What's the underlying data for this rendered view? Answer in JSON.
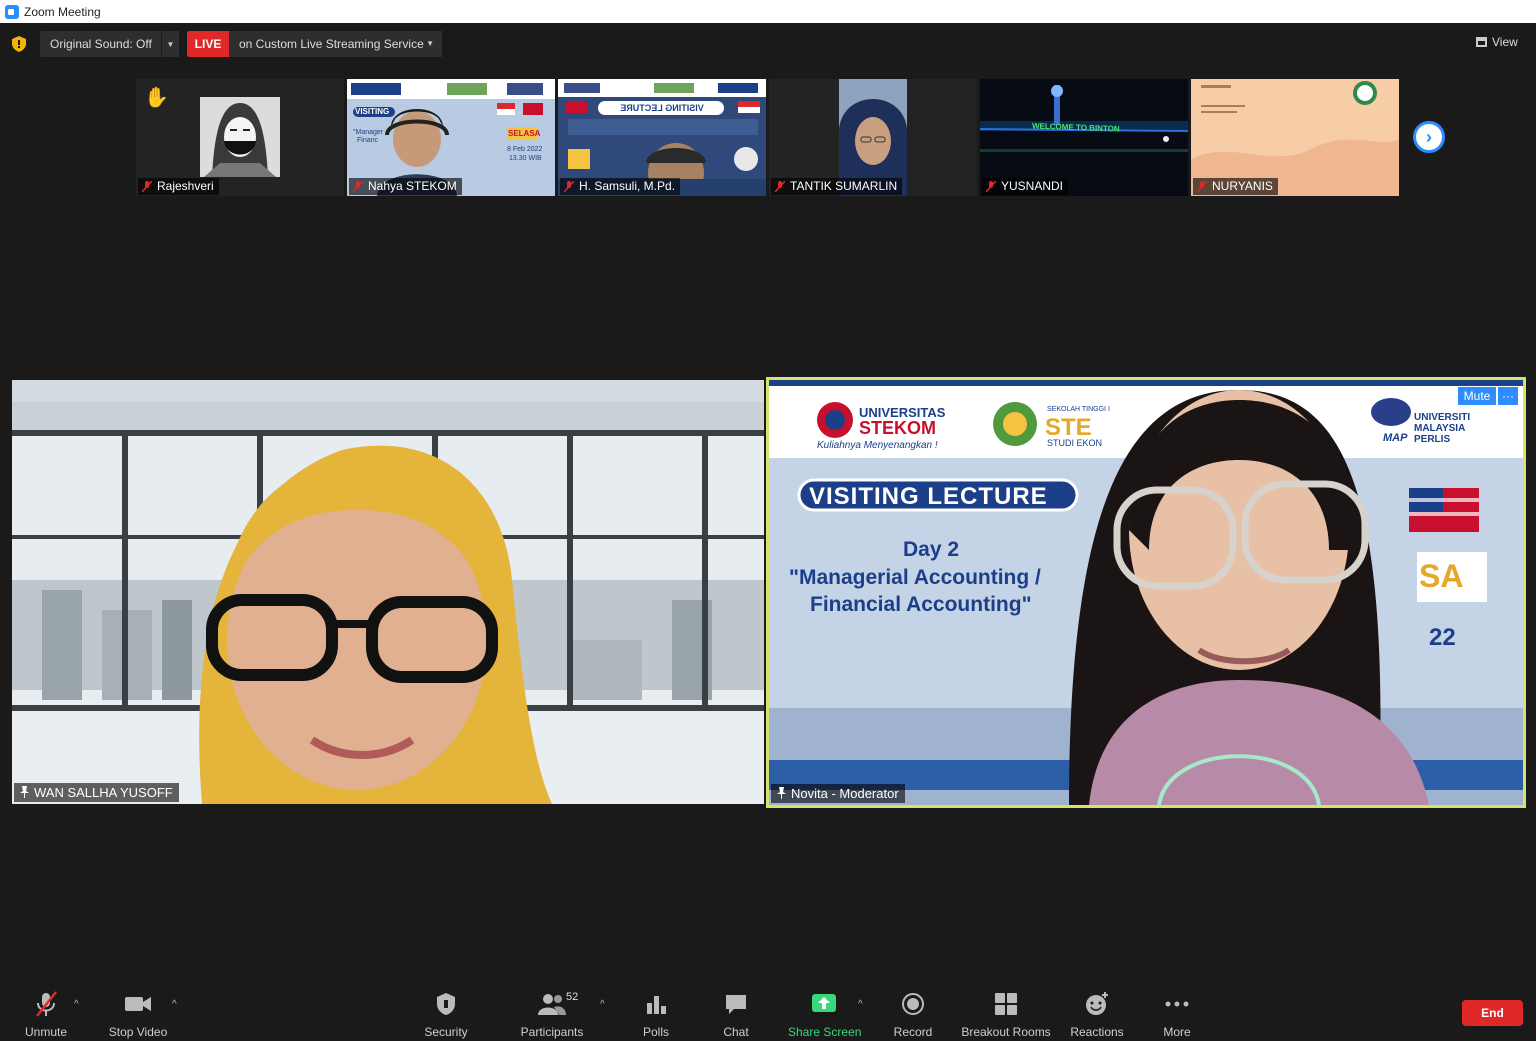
{
  "window": {
    "title": "Zoom Meeting"
  },
  "topbar": {
    "original_sound": "Original Sound: Off",
    "live_badge": "LIVE",
    "live_service": "on Custom Live Streaming Service",
    "view": "View"
  },
  "thumbnails": [
    {
      "name": "Rajeshveri",
      "muted": true,
      "hand_raised": true
    },
    {
      "name": "Nahya STEKOM",
      "muted": true
    },
    {
      "name": "H. Samsuli, M.Pd.",
      "muted": true
    },
    {
      "name": "TANTIK SUMARLIN",
      "muted": true
    },
    {
      "name": "YUSNANDI",
      "muted": true
    },
    {
      "name": "NURYANIS",
      "muted": true
    }
  ],
  "thumb_texts": {
    "visiting": "VISITING",
    "managerial": "\"Manager",
    "financial": "Financ",
    "selasa": "SELASA",
    "date": "8 Feb 2022",
    "time": "13.30 WIB",
    "visiting_lecture_mirrored": "VISITING LECTURE",
    "welcome": "WELCOME TO BINTON"
  },
  "main_videos": {
    "left": {
      "name": "WAN SALLHA YUSOFF"
    },
    "right": {
      "name": "Novita - Moderator",
      "mute_label": "Mute",
      "more_label": "···",
      "slide": {
        "uni1_line1": "UNIVERSITAS",
        "uni1_line2": "STEKOM",
        "uni1_tagline": "Kuliahnya Menyenangkan !",
        "uni2_small": "SEKOLAH TINGGI I",
        "uni2_big": "STE",
        "uni2_sub": "STUDI EKON",
        "unimap_tag": "MAP",
        "unimap_line1": "UNIVERSITI",
        "unimap_line2": "MALAYSIA",
        "unimap_line3": "PERLIS",
        "banner": "VISITING LECTURE",
        "day": "Day 2",
        "topic_line1": "\"Managerial Accounting /",
        "topic_line2": "Financial Accounting\"",
        "partial_sa": "SA",
        "partial_22": "22"
      }
    }
  },
  "toolbar": {
    "unmute": "Unmute",
    "stop_video": "Stop Video",
    "security": "Security",
    "participants": "Participants",
    "participant_count": "52",
    "polls": "Polls",
    "chat": "Chat",
    "share_screen": "Share Screen",
    "record": "Record",
    "breakout_rooms": "Breakout Rooms",
    "reactions": "Reactions",
    "more": "More",
    "end": "End"
  },
  "colors": {
    "accent": "#2d8cff",
    "live": "#e02828",
    "active_speaker": "#d4e26e",
    "share": "#38d97a"
  }
}
